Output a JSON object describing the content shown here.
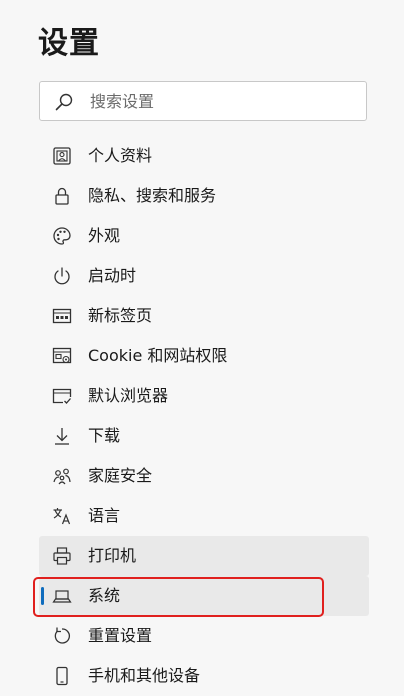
{
  "page": {
    "title": "设置"
  },
  "search": {
    "placeholder": "搜索设置",
    "icon": "search-icon"
  },
  "nav": {
    "items": [
      {
        "label": "个人资料",
        "icon": "profile-icon"
      },
      {
        "label": "隐私、搜索和服务",
        "icon": "lock-icon"
      },
      {
        "label": "外观",
        "icon": "palette-icon"
      },
      {
        "label": "启动时",
        "icon": "power-icon"
      },
      {
        "label": "新标签页",
        "icon": "new-tab-icon"
      },
      {
        "label": "Cookie 和网站权限",
        "icon": "site-permissions-icon"
      },
      {
        "label": "默认浏览器",
        "icon": "default-browser-icon"
      },
      {
        "label": "下载",
        "icon": "download-icon"
      },
      {
        "label": "家庭安全",
        "icon": "family-icon"
      },
      {
        "label": "语言",
        "icon": "language-icon"
      },
      {
        "label": "打印机",
        "icon": "printer-icon",
        "state": "hover"
      },
      {
        "label": "系统",
        "icon": "laptop-icon",
        "state": "selected"
      },
      {
        "label": "重置设置",
        "icon": "reset-icon"
      },
      {
        "label": "手机和其他设备",
        "icon": "phone-icon"
      }
    ]
  },
  "colors": {
    "accent": "#0f6cbd",
    "annotation": "#e0201e",
    "hover": "#e9e9e9"
  }
}
